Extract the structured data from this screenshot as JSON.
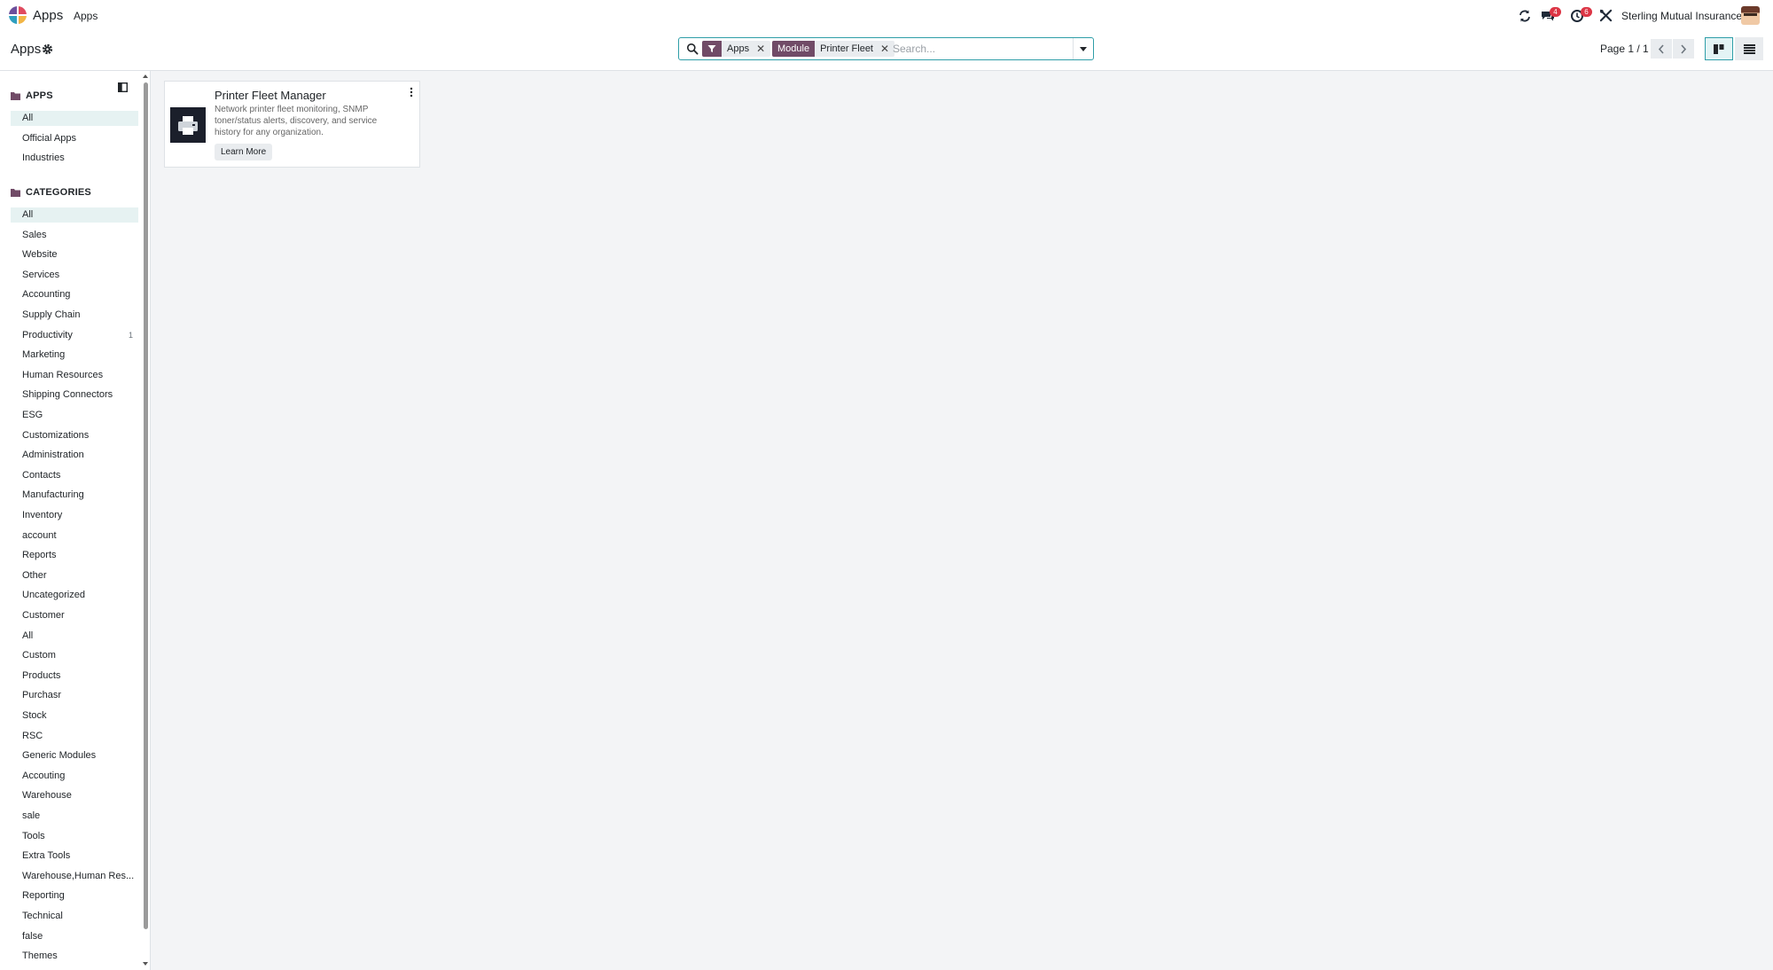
{
  "navbar": {
    "brand": "Apps",
    "menu_item": "Apps",
    "messages_count": "4",
    "activities_count": "6",
    "company": "Sterling Mutual Insurance"
  },
  "control_panel": {
    "title": "Apps",
    "facets": [
      {
        "label_icon": "filter-icon",
        "values": "Apps"
      },
      {
        "label": "Module",
        "values": "Printer Fleet"
      }
    ],
    "search_placeholder": "Search...",
    "pager": "Page 1 / 1"
  },
  "sidebar": {
    "apps_heading": "APPS",
    "apps_items": [
      {
        "label": "All",
        "active": true
      },
      {
        "label": "Official Apps"
      },
      {
        "label": "Industries"
      }
    ],
    "categories_heading": "CATEGORIES",
    "category_items": [
      {
        "label": "All",
        "active": true
      },
      {
        "label": "Sales"
      },
      {
        "label": "Website"
      },
      {
        "label": "Services"
      },
      {
        "label": "Accounting"
      },
      {
        "label": "Supply Chain"
      },
      {
        "label": "Productivity",
        "count": "1"
      },
      {
        "label": "Marketing"
      },
      {
        "label": "Human Resources"
      },
      {
        "label": "Shipping Connectors"
      },
      {
        "label": "ESG"
      },
      {
        "label": "Customizations"
      },
      {
        "label": "Administration"
      },
      {
        "label": "Contacts"
      },
      {
        "label": "Manufacturing"
      },
      {
        "label": "Inventory"
      },
      {
        "label": "account"
      },
      {
        "label": "Reports"
      },
      {
        "label": "Other"
      },
      {
        "label": "Uncategorized"
      },
      {
        "label": "Customer"
      },
      {
        "label": "All"
      },
      {
        "label": "Custom"
      },
      {
        "label": "Products"
      },
      {
        "label": "Purchasr"
      },
      {
        "label": "Stock"
      },
      {
        "label": "RSC"
      },
      {
        "label": "Generic Modules"
      },
      {
        "label": "Accouting"
      },
      {
        "label": "Warehouse"
      },
      {
        "label": "sale"
      },
      {
        "label": "Tools"
      },
      {
        "label": "Extra Tools"
      },
      {
        "label": "Warehouse,Human Res..."
      },
      {
        "label": "Reporting"
      },
      {
        "label": "Technical"
      },
      {
        "label": "false"
      },
      {
        "label": "Themes"
      }
    ]
  },
  "apps": [
    {
      "name": "Printer Fleet Manager",
      "description": "Network printer fleet monitoring, SNMP toner/status alerts, discovery, and service history for any organization.",
      "button": "Learn More",
      "icon": "printer-icon"
    }
  ],
  "colors": {
    "brand_purple": "#714b67",
    "accent_teal": "#2f9ea8",
    "badge_red": "#dc3545"
  }
}
